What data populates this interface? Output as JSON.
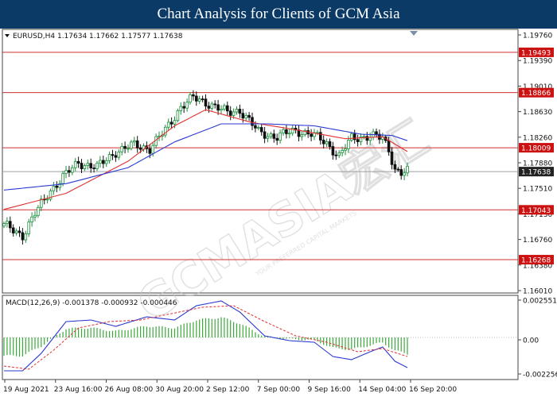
{
  "banner": {
    "title": "Chart Analysis for Clients of GCM Asia"
  },
  "watermark": {
    "brand": "GCMASIA宏汇",
    "tagline": "YOUR PREFERRED CAPITAL MARKETS"
  },
  "colors": {
    "candle_up": "#1a8f3a",
    "candle_down": "#111111",
    "ma_fast": "#e03030",
    "ma_slow": "#2a3ad0",
    "resistance": "#d03030",
    "last_price_line": "#9aa0a8",
    "price_tag": "#cc1111",
    "last_tag": "#222222",
    "macd_line": "#2a3ad0",
    "signal_line": "#e03030",
    "histogram": "#3aa83a"
  },
  "chart_data": [
    {
      "type": "candlestick",
      "title": "EURUSD,H4",
      "ohlc_label": "1.17634 1.17662 1.17577 1.17638",
      "last_price": 1.17638,
      "ylim": [
        1.1575,
        1.1985
      ],
      "y_ticks": [
        "1.19760",
        "1.19390",
        "1.19010",
        "1.18630",
        "1.18260",
        "1.17880",
        "1.17510",
        "1.17130",
        "1.16760",
        "1.16380",
        "1.16010"
      ],
      "resistance_levels": [
        1.19493,
        1.18866,
        1.18009
      ],
      "support_levels": [
        1.17043,
        1.16268
      ],
      "level_labels": [
        "1.19493",
        "1.18866",
        "1.18009",
        "1.17043",
        "1.16268"
      ],
      "last_label": "1.17638",
      "x_tick_labels": [
        "19 Aug 2021",
        "23 Aug 16:00",
        "26 Aug 08:00",
        "30 Aug 20:00",
        "2 Sep 12:00",
        "7 Sep 00:00",
        "9 Sep 16:00",
        "14 Sep 04:00",
        "16 Sep 20:00"
      ],
      "close_anchors": [
        [
          0,
          1.168
        ],
        [
          6,
          1.1665
        ],
        [
          10,
          1.1698
        ],
        [
          15,
          1.1735
        ],
        [
          19,
          1.1755
        ],
        [
          24,
          1.1778
        ],
        [
          30,
          1.177
        ],
        [
          36,
          1.1795
        ],
        [
          42,
          1.1805
        ],
        [
          47,
          1.18
        ],
        [
          52,
          1.1828
        ],
        [
          57,
          1.1865
        ],
        [
          61,
          1.1878
        ],
        [
          66,
          1.187
        ],
        [
          72,
          1.1855
        ],
        [
          76,
          1.186
        ],
        [
          82,
          1.1825
        ],
        [
          88,
          1.1818
        ],
        [
          94,
          1.1828
        ],
        [
          99,
          1.1822
        ],
        [
          104,
          1.1808
        ],
        [
          108,
          1.1788
        ],
        [
          112,
          1.1815
        ],
        [
          118,
          1.182
        ],
        [
          122,
          1.1815
        ],
        [
          124,
          1.1798
        ],
        [
          126,
          1.1768
        ],
        [
          128,
          1.1762
        ],
        [
          130,
          1.1764
        ]
      ],
      "moving_averages": [
        {
          "anchors": [
            [
              0,
              1.1705
            ],
            [
              20,
              1.173
            ],
            [
              40,
              1.178
            ],
            [
              55,
              1.1835
            ],
            [
              65,
              1.186
            ],
            [
              80,
              1.184
            ],
            [
              95,
              1.1828
            ],
            [
              110,
              1.1815
            ],
            [
              122,
              1.1818
            ],
            [
              130,
              1.1795
            ]
          ]
        },
        {
          "anchors": [
            [
              0,
              1.1735
            ],
            [
              20,
              1.1745
            ],
            [
              40,
              1.177
            ],
            [
              55,
              1.181
            ],
            [
              70,
              1.1838
            ],
            [
              85,
              1.1838
            ],
            [
              100,
              1.1835
            ],
            [
              115,
              1.1822
            ],
            [
              125,
              1.182
            ],
            [
              130,
              1.1812
            ]
          ]
        }
      ]
    },
    {
      "type": "macd",
      "title": "MACD(12,26,9)",
      "values_label": "-0.001378 -0.000932 -0.000446",
      "ylim": [
        -0.00265,
        0.00265
      ],
      "y_ticks": [
        "0.002551",
        "0.00",
        "-0.002256"
      ],
      "macd_anchors": [
        [
          0,
          -0.0021
        ],
        [
          6,
          -0.0021
        ],
        [
          12,
          -0.001
        ],
        [
          20,
          0.001
        ],
        [
          28,
          0.0011
        ],
        [
          36,
          0.0007
        ],
        [
          46,
          0.0013
        ],
        [
          55,
          0.0011
        ],
        [
          62,
          0.002
        ],
        [
          70,
          0.0023
        ],
        [
          76,
          0.0016
        ],
        [
          84,
          0.0001
        ],
        [
          92,
          -0.0002
        ],
        [
          100,
          -0.0003
        ],
        [
          106,
          -0.0012
        ],
        [
          112,
          -0.0014
        ],
        [
          118,
          -0.0009
        ],
        [
          122,
          -0.0006
        ],
        [
          126,
          -0.0015
        ],
        [
          130,
          -0.0019
        ]
      ],
      "signal_anchors": [
        [
          0,
          -0.0018
        ],
        [
          8,
          -0.002
        ],
        [
          16,
          -0.0008
        ],
        [
          24,
          0.0006
        ],
        [
          34,
          0.001
        ],
        [
          44,
          0.0011
        ],
        [
          54,
          0.0015
        ],
        [
          64,
          0.0019
        ],
        [
          74,
          0.002
        ],
        [
          84,
          0.001
        ],
        [
          94,
          0.0001
        ],
        [
          104,
          -0.0003
        ],
        [
          114,
          -0.0009
        ],
        [
          122,
          -0.0007
        ],
        [
          130,
          -0.0012
        ]
      ]
    }
  ]
}
